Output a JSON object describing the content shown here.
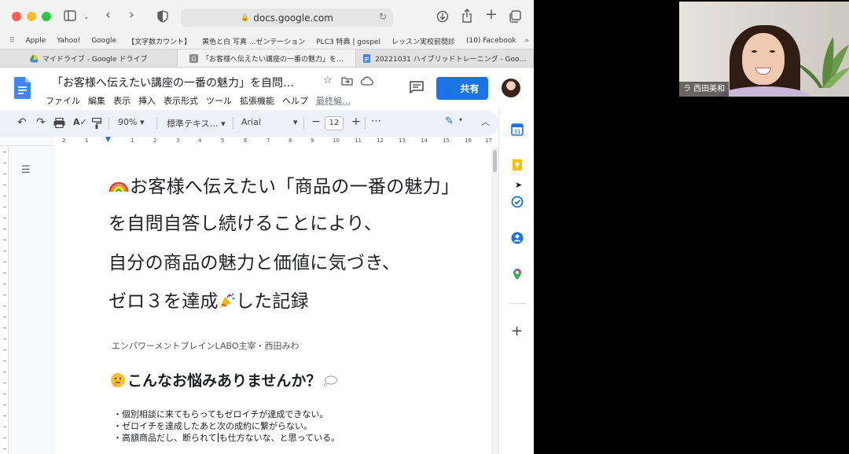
{
  "browser": {
    "url": "docs.google.com",
    "bookmarks": [
      "Apple",
      "Yahoo!",
      "Google",
      "【文字数カウント】",
      "黄色と白 写真 ...ゼンテーション",
      "PLC3 特典 | gospel",
      "レッスン実校前問診",
      "(10) Facebook"
    ],
    "tabs": [
      {
        "label": "マイドライブ - Google ドライブ",
        "active": false
      },
      {
        "label": "「お客様へ伝えたい講座の一番の魅力」を…",
        "active": true
      },
      {
        "label": "20221031 ハイブリッドトレーニング - Goo…",
        "active": false
      }
    ]
  },
  "docs": {
    "title": "「お客様へ伝えたい講座の一番の魅力」を自問…",
    "menu": [
      "ファイル",
      "編集",
      "表示",
      "挿入",
      "表示形式",
      "ツール",
      "拡張機能",
      "ヘルプ"
    ],
    "last_edit": "最終編…",
    "share_label": "共有",
    "toolbar": {
      "zoom": "90%",
      "style": "標準テキス…",
      "font": "Arial",
      "font_size": "12",
      "more": "⋯"
    },
    "ruler_marks": [
      "2",
      "1",
      "1",
      "2",
      "3",
      "4",
      "5",
      "6",
      "7",
      "8",
      "9",
      "10",
      "11",
      "12",
      "13",
      "14",
      "15",
      "16",
      "17"
    ]
  },
  "document": {
    "heading_lines": [
      "お客様へ伝えたい「商品の一番の魅力」",
      "を自問自答し続けることにより、",
      "自分の商品の魅力と価値に気づき、",
      "ゼロ３を達成",
      "した記録"
    ],
    "author": "エンパワーメントブレインLABO主宰・西田みわ",
    "subheading": "こんなお悩みありませんか？",
    "bullets": [
      "・個別相談に来てもらってもゼロイチが達成できない。",
      "・ゼロイチを達成したあと次の成約に繋がらない。",
      "・高額商品だし、断られて",
      "も仕方ないな、と思っている。"
    ]
  },
  "video": {
    "participant_label": "ラ 西田美和"
  },
  "colors": {
    "accent": "#1a73e8",
    "toolbar_bg": "#edf2fa",
    "titlebar_bg": "#f3f2f2"
  },
  "icons": [
    "sidebar-icon",
    "back-icon",
    "forward-icon",
    "shield-icon",
    "lock-icon",
    "reload-icon",
    "download-icon",
    "share-icon",
    "new-tab-icon",
    "tabs-icon",
    "star-icon",
    "move-icon",
    "cloud-icon",
    "comment-icon",
    "undo-icon",
    "redo-icon",
    "print-icon",
    "spellcheck-icon",
    "paint-format-icon",
    "pencil-icon",
    "calendar-icon",
    "keep-icon",
    "tasks-icon",
    "contacts-icon",
    "maps-icon",
    "plus-icon",
    "outline-icon"
  ]
}
